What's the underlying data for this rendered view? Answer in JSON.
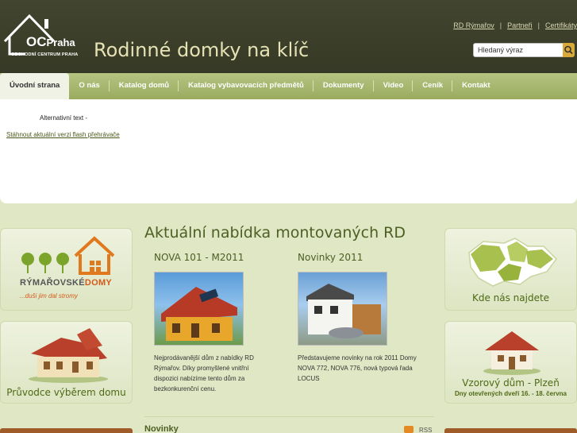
{
  "header": {
    "logo_main": "OC",
    "logo_city": "Praha",
    "logo_sub": "OBCHODNÍ CENTRUM PRAHA",
    "site_title": "Rodinné domky na klíč",
    "links": [
      "RD Rýmařov",
      "Partneři",
      "Certifikáty"
    ],
    "search_placeholder": "Hledaný výraz"
  },
  "nav": {
    "items": [
      "Úvodní strana",
      "O nás",
      "Katalog domů",
      "Katalog vybavovacích předmětů",
      "Dokumenty",
      "Video",
      "Ceník",
      "Kontakt"
    ],
    "active_index": 0
  },
  "flash": {
    "alt_text": "Alternativní text -",
    "download_link": "Stáhnout aktuální verzi flash přehrávače"
  },
  "left_boxes": {
    "brand_part1": "RÝMAŘOVSKÉ",
    "brand_part2": "DOMY",
    "brand_slogan": "...duši jim dal stromy",
    "guide_caption": "Průvodce výběrem domu"
  },
  "right_boxes": {
    "map_caption": "Kde nás najdete",
    "model_caption": "Vzorový dům - Plzeň",
    "model_sub": "Dny otevřených dveří 16. - 18. června"
  },
  "main": {
    "title": "Aktuální nabídka montovaných RD",
    "col1_title": "NOVA 101 - M2011",
    "col1_text": "Nejprodávanější dům z nabídky RD Rýmařov. Díky promyšlené vnitřní dispozici nabízíme tento dům za bezkonkurenční cenu.",
    "col2_title": "Novinky 2011",
    "col2_text": "Představujeme novinky na rok 2011 Domy NOVA 772, NOVA 776, nová typová řada LOCUS",
    "news_title": "Novinky",
    "rss_label": "RSS"
  },
  "colors": {
    "header_bg": "#3c3f2c",
    "nav_bg": "#a6b66d",
    "accent_green": "#4e5f24",
    "accent_orange": "#d35a18"
  }
}
